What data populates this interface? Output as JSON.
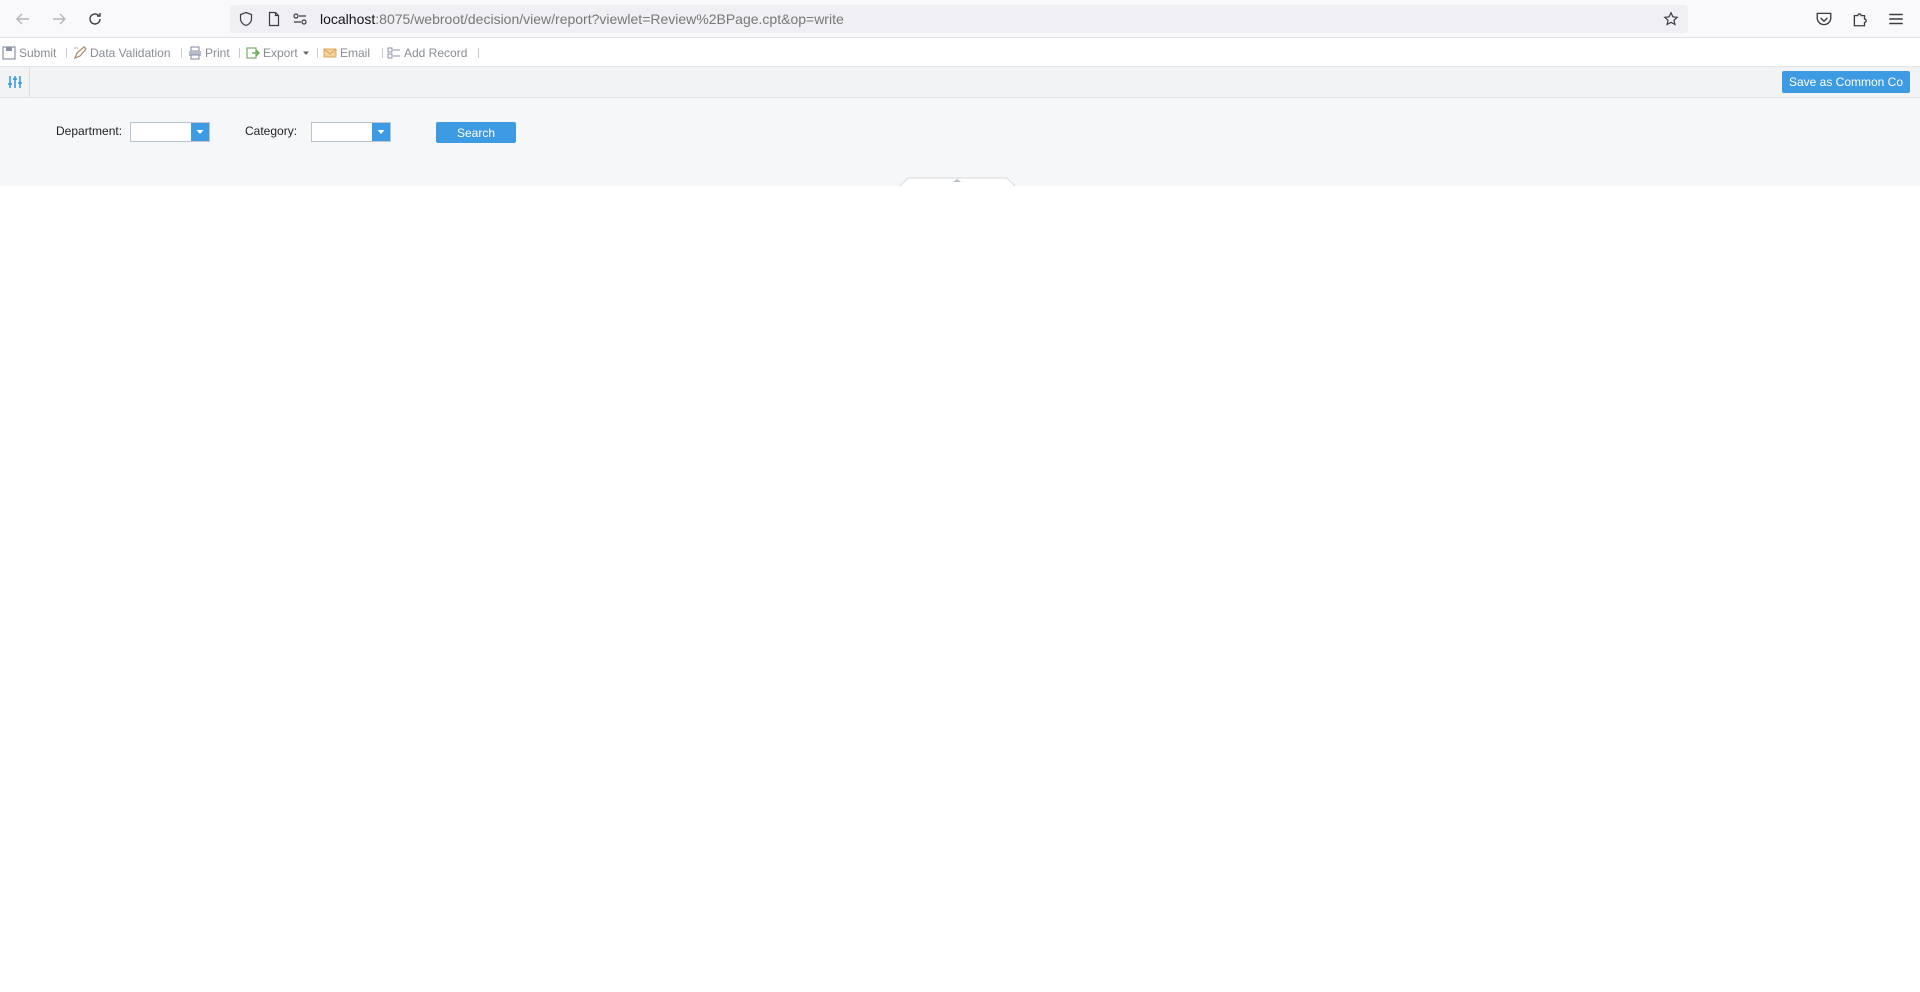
{
  "browser": {
    "url_host": "localhost",
    "url_rest": ":8075/webroot/decision/view/report?viewlet=Review%2BPage.cpt&op=write"
  },
  "toolbar": {
    "submit": "Submit",
    "data_validation": "Data Validation",
    "print": "Print",
    "export": "Export",
    "email": "Email",
    "add_record": "Add Record"
  },
  "param_header": {
    "save_common": "Save as Common Co"
  },
  "params": {
    "department_label": "Department:",
    "department_value": "",
    "category_label": "Category:",
    "category_value": "",
    "search_label": "Search"
  },
  "colors": {
    "accent": "#3d9be3"
  }
}
